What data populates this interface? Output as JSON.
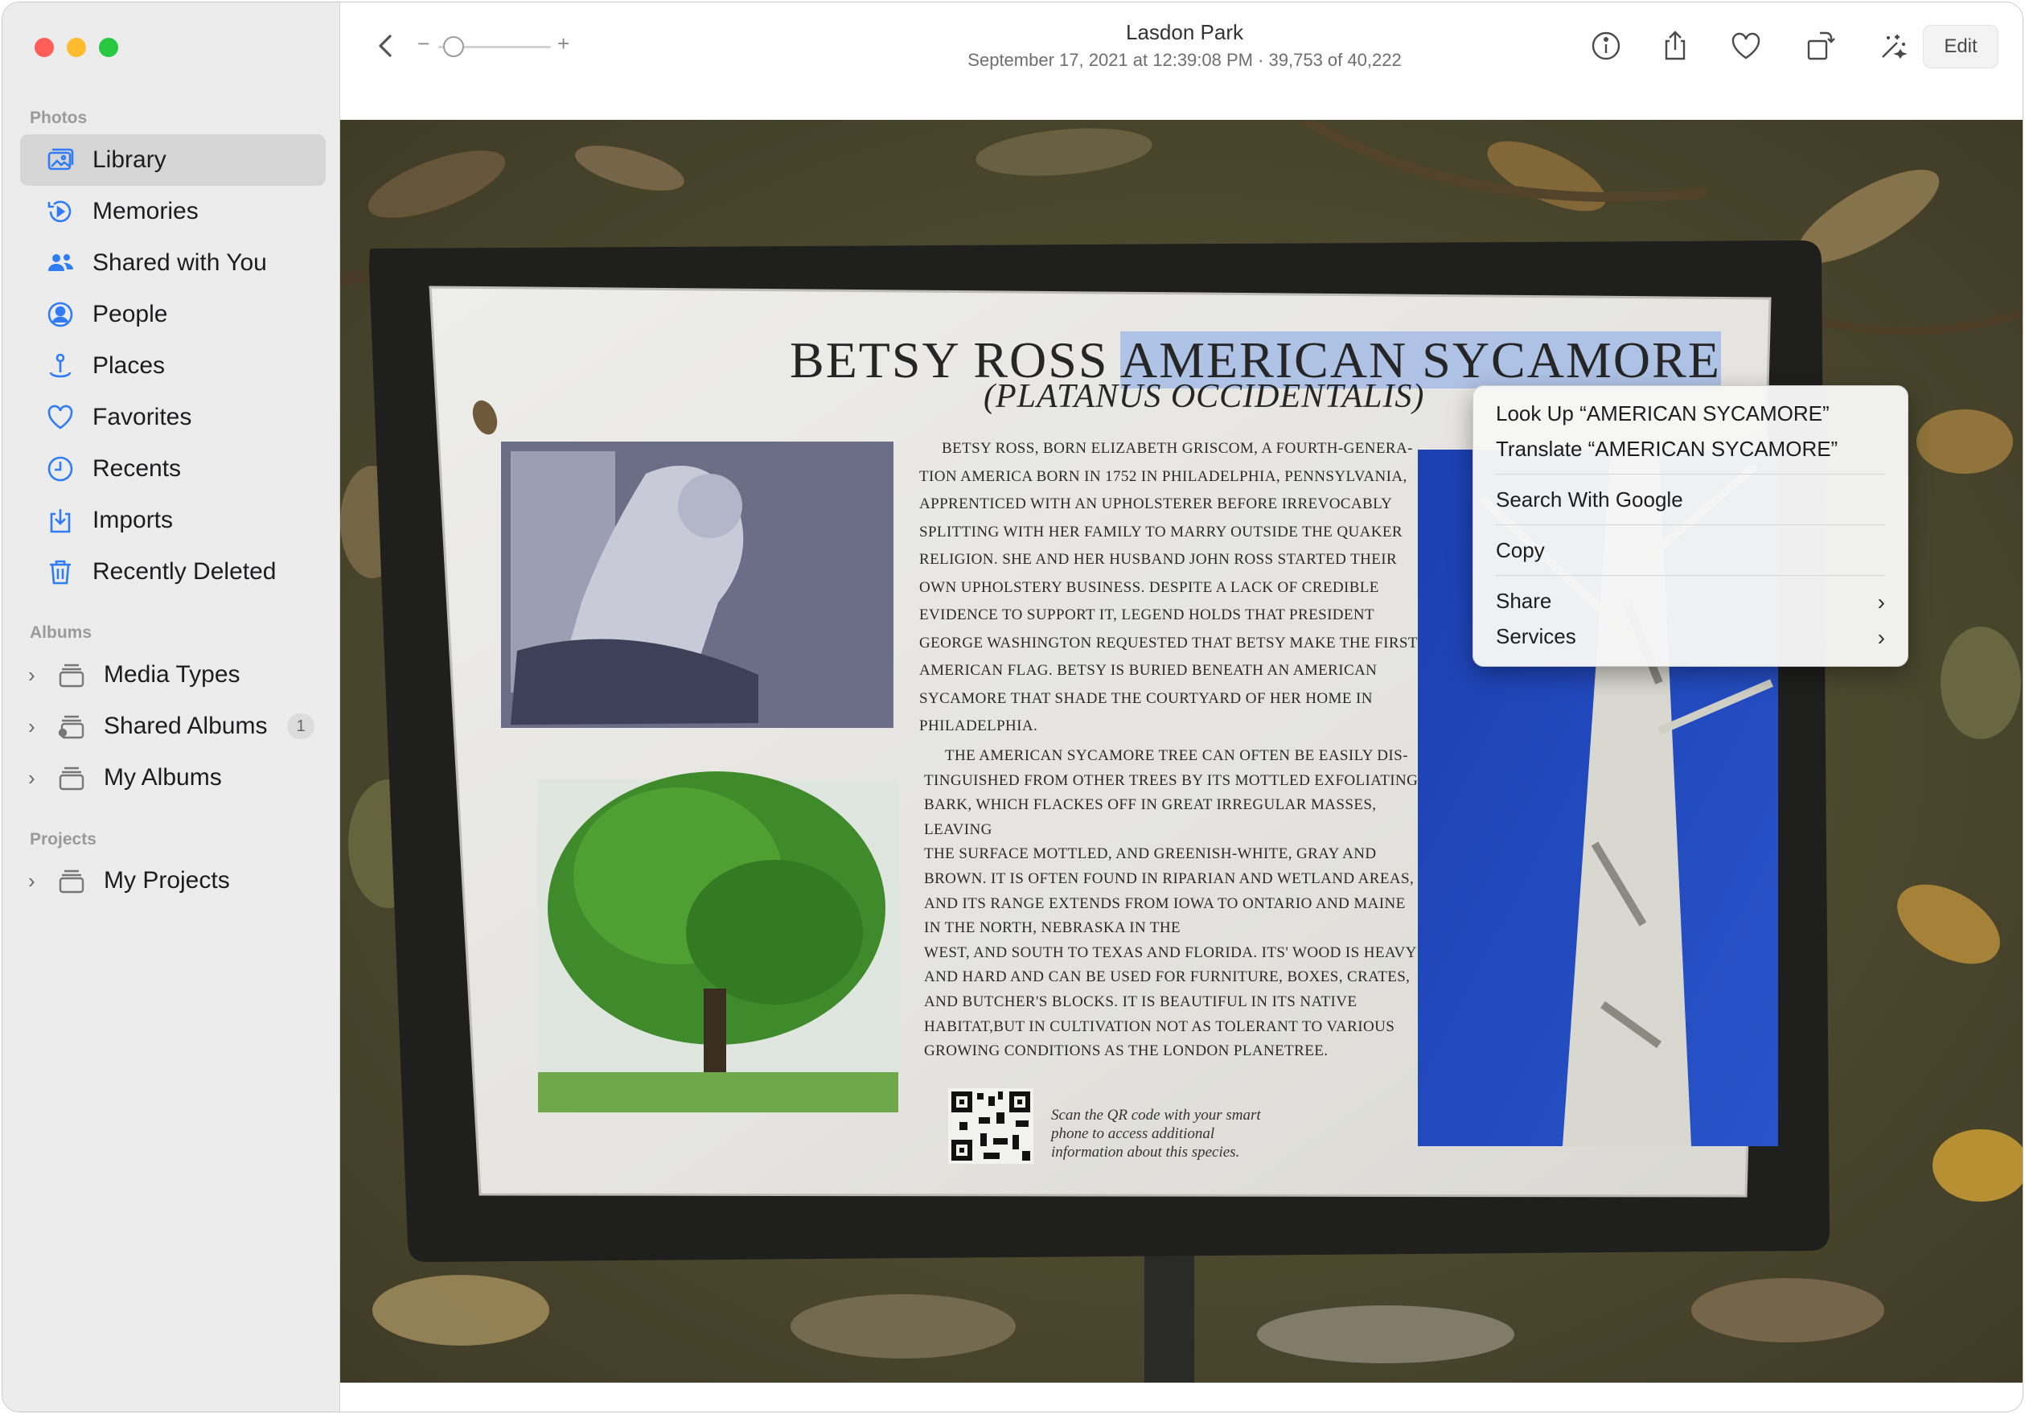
{
  "window": {
    "title": "Lasdon Park",
    "subtitle": "September 17, 2021 at 12:39:08 PM  ·  39,753 of 40,222"
  },
  "colors": {
    "traffic_close": "#ff5f57",
    "traffic_min": "#febc2e",
    "traffic_max": "#28c840",
    "accent": "#2f7cf6",
    "text_highlight": "#91afe6"
  },
  "toolbar": {
    "zoom_minus": "−",
    "zoom_plus": "+",
    "zoom_level": 0.05,
    "edit_label": "Edit",
    "icons": [
      "back-icon",
      "info-icon",
      "share-icon",
      "favorite-icon",
      "rotate-icon",
      "auto-enhance-icon"
    ]
  },
  "sidebar": {
    "photos_header": "Photos",
    "albums_header": "Albums",
    "projects_header": "Projects",
    "items": [
      {
        "label": "Library",
        "icon": "library-icon"
      },
      {
        "label": "Memories",
        "icon": "memories-icon"
      },
      {
        "label": "Shared with You",
        "icon": "shared-with-you-icon"
      },
      {
        "label": "People",
        "icon": "people-icon"
      },
      {
        "label": "Places",
        "icon": "places-icon"
      },
      {
        "label": "Favorites",
        "icon": "favorites-icon"
      },
      {
        "label": "Recents",
        "icon": "recents-icon"
      },
      {
        "label": "Imports",
        "icon": "imports-icon"
      },
      {
        "label": "Recently Deleted",
        "icon": "trash-icon"
      }
    ],
    "albums": [
      {
        "label": "Media Types",
        "icon": "album-stack-icon"
      },
      {
        "label": "Shared Albums",
        "icon": "shared-album-icon",
        "badge": "1"
      },
      {
        "label": "My Albums",
        "icon": "album-stack-icon"
      }
    ],
    "projects": [
      {
        "label": "My Projects",
        "icon": "album-stack-icon"
      }
    ]
  },
  "sign": {
    "title_plain": "BETSY ROSS ",
    "title_selected": "AMERICAN SYCAMORE",
    "subtitle": "(PLATANUS OCCIDENTALIS)",
    "body_lines_1": [
      "Betsy ross, born elizabeth griscom, a fourth-genera-",
      "tion america born in 1752 in philadelphia, pennsylvania,",
      "apprenticed with an upholsterer before irrevocably",
      "splitting with her family to marry outside the quaker",
      "religion. she and her husband john ross started their",
      "own upholstery business. despite a lack of credible",
      "evidence to support it, legend holds that president",
      "george washington requested that betsy make the first",
      "american flag. betsy is buried beneath an american",
      "sycamore that shade the courtyard of her home in",
      "philadelphia."
    ],
    "body_lines_2": [
      "The american sycamore tree can often be easily dis-",
      "tinguished from other trees by its mottled exfoliating",
      "bark, which flackes off in great irregular masses, leaving",
      "the surface mottled, and greenish-white, gray and",
      "brown. it is often found in riparian and wetland areas,",
      "and its range extends from iowa to ontario and maine",
      "in the north, nebraska in the",
      "west, and south to texas and florida. its' wood is heavy",
      "and hard and can be used for furniture, boxes, crates,",
      "and butcher's blocks. it is beautiful in its native",
      "habitat,but in cultivation not as tolerant to various",
      "growing conditions as the london planetree."
    ],
    "qr_text": [
      "Scan the QR code with your smart",
      "phone  to access additional",
      "information about this species."
    ]
  },
  "context_menu": {
    "look_up": "Look Up “AMERICAN SYCAMORE”",
    "translate": "Translate “AMERICAN SYCAMORE”",
    "search": "Search With Google",
    "copy": "Copy",
    "share": "Share",
    "services": "Services",
    "submenu_arrow": "›"
  }
}
